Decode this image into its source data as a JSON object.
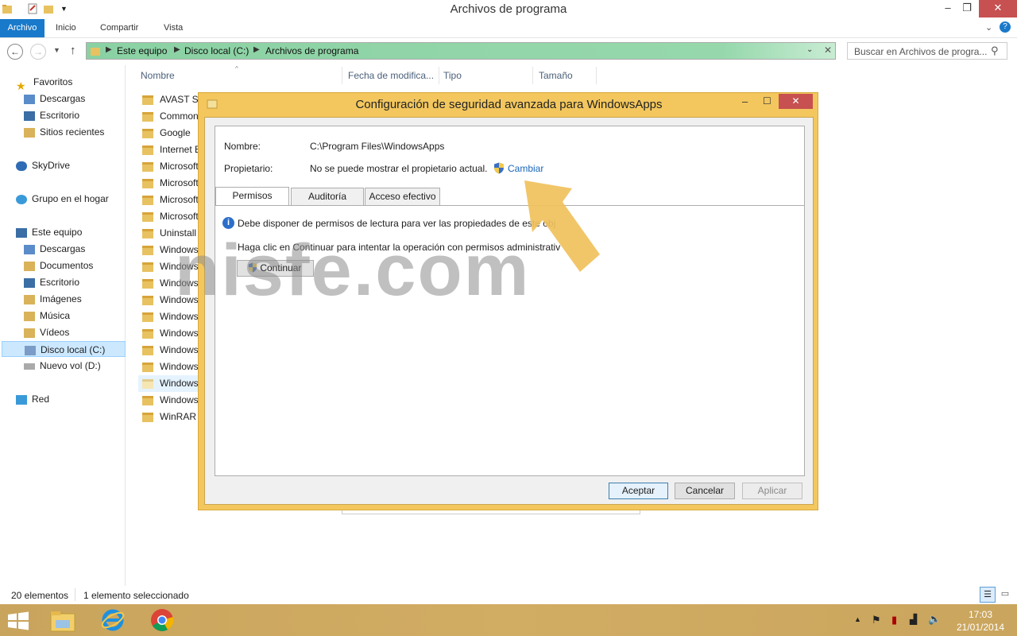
{
  "window": {
    "title": "Archivos de programa",
    "controls": {
      "minimize": "–",
      "maximize": "❐",
      "close": "✕"
    }
  },
  "ribbon": {
    "tabs": [
      "Archivo",
      "Inicio",
      "Compartir",
      "Vista"
    ],
    "help_icon": "help-icon"
  },
  "address": {
    "crumbs": [
      "Este equipo",
      "Disco local (C:)",
      "Archivos de programa"
    ],
    "search_placeholder": "Buscar en Archivos de progra..."
  },
  "sidebar": {
    "favorites": {
      "label": "Favoritos",
      "items": [
        "Descargas",
        "Escritorio",
        "Sitios recientes"
      ]
    },
    "skydrive": "SkyDrive",
    "homegroup": "Grupo en el hogar",
    "computer": {
      "label": "Este equipo",
      "items": [
        "Descargas",
        "Documentos",
        "Escritorio",
        "Imágenes",
        "Música",
        "Vídeos",
        "Disco local (C:)",
        "Nuevo vol (D:)"
      ]
    },
    "network": "Red"
  },
  "columns": [
    "Nombre",
    "Fecha de modifica...",
    "Tipo",
    "Tamaño"
  ],
  "files": [
    "AVAST Software",
    "Common Files",
    "Google",
    "Internet Explorer",
    "Microsoft",
    "Microsoft",
    "Microsoft",
    "Microsoft",
    "Uninstall Information",
    "Windows",
    "Windows",
    "Windows",
    "Windows",
    "Windows",
    "Windows",
    "Windows",
    "Windows",
    "WindowsApps",
    "WindowsPowerShell",
    "WinRAR"
  ],
  "files_visible": [
    "AVAST So",
    "Common",
    "Google",
    "Internet E",
    "Microsoft",
    "Microsoft",
    "Microsoft",
    "Microsoft",
    "Uninstall I",
    "Windows",
    "Windows",
    "Windows",
    "Windows",
    "Windows",
    "Windows",
    "Windows",
    "Windows",
    "WindowsA",
    "WindowsI",
    "WinRAR"
  ],
  "status": {
    "count": "20 elementos",
    "selected": "1 elemento seleccionado"
  },
  "dialog": {
    "title": "Configuración de seguridad avanzada para WindowsApps",
    "name_label": "Nombre:",
    "name_value": "C:\\Program Files\\WindowsApps",
    "owner_label": "Propietario:",
    "owner_value": "No se puede mostrar el propietario actual.",
    "change_link": "Cambiar",
    "tabs": [
      "Permisos",
      "Auditoría",
      "Acceso efectivo"
    ],
    "info_text": "Debe disponer de permisos de lectura para ver las propiedades de este obj",
    "continue_hint": "Haga clic en Continuar para intentar la operación con permisos administrativ",
    "continue_button": "Continuar",
    "buttons": {
      "ok": "Aceptar",
      "cancel": "Cancelar",
      "apply": "Aplicar"
    }
  },
  "watermark": "nisfe.com",
  "taskbar": {
    "time": "17:03",
    "date": "21/01/2014"
  },
  "colors": {
    "accent": "#1979ca",
    "dialog_frame": "#f3c75e",
    "address_bar": "#8ad1a3",
    "arrow": "#f0c15c",
    "taskbar": "#c9a45c"
  }
}
